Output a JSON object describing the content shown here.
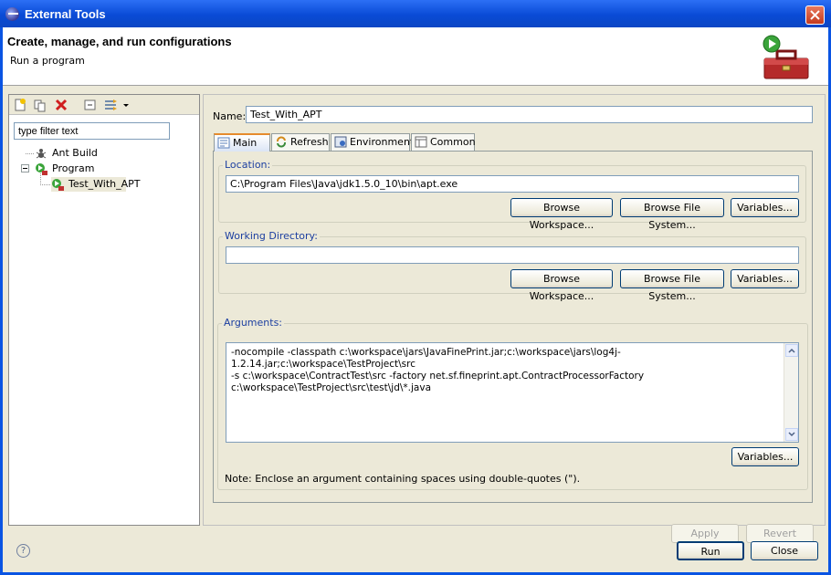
{
  "window": {
    "title": "External Tools",
    "header_title": "Create, manage, and run configurations",
    "header_subtitle": "Run a program"
  },
  "toolbar": {
    "icons": [
      "new-config-icon",
      "duplicate-icon",
      "delete-icon",
      "collapse-all-icon",
      "filter-icon",
      "dropdown-arrow-icon"
    ]
  },
  "filter": {
    "placeholder": "type filter text",
    "value": "type filter text"
  },
  "tree": {
    "items": [
      {
        "label": "Ant Build",
        "icon": "ant-icon"
      },
      {
        "label": "Program",
        "icon": "program-icon"
      },
      {
        "label": "Test_With_APT",
        "icon": "program-config-icon"
      }
    ]
  },
  "config": {
    "name_label": "Name:",
    "name_value": "Test_With_APT",
    "tabs": [
      {
        "label": "Main",
        "icon": "main-tab-icon"
      },
      {
        "label": "Refresh",
        "icon": "refresh-icon"
      },
      {
        "label": "Environment",
        "icon": "environment-icon"
      },
      {
        "label": "Common",
        "icon": "common-icon"
      }
    ],
    "location": {
      "label": "Location:",
      "value": "C:\\Program Files\\Java\\jdk1.5.0_10\\bin\\apt.exe",
      "buttons": [
        "Browse Workspace...",
        "Browse File System...",
        "Variables..."
      ]
    },
    "working_dir": {
      "label": "Working Directory:",
      "value": "",
      "buttons": [
        "Browse Workspace...",
        "Browse File System...",
        "Variables..."
      ]
    },
    "arguments": {
      "label": "Arguments:",
      "value": "-nocompile -classpath c:\\workspace\\jars\\JavaFinePrint.jar;c:\\workspace\\jars\\log4j-1.2.14.jar;c:\\workspace\\TestProject\\src\n-s c:\\workspace\\ContractTest\\src -factory net.sf.fineprint.apt.ContractProcessorFactory\nc:\\workspace\\TestProject\\src\\test\\jd\\*.java",
      "variables_button": "Variables...",
      "note": "Note: Enclose an argument containing spaces using double-quotes (\")."
    },
    "apply_button": "Apply",
    "revert_button": "Revert"
  },
  "footer": {
    "help_glyph": "?",
    "run_button": "Run",
    "close_button": "Close"
  },
  "colors": {
    "title_bar": "#0a54e3",
    "dialog_bg": "#ece9d8",
    "tab_accent": "#e68b2c",
    "group_label": "#1c3fa0"
  }
}
